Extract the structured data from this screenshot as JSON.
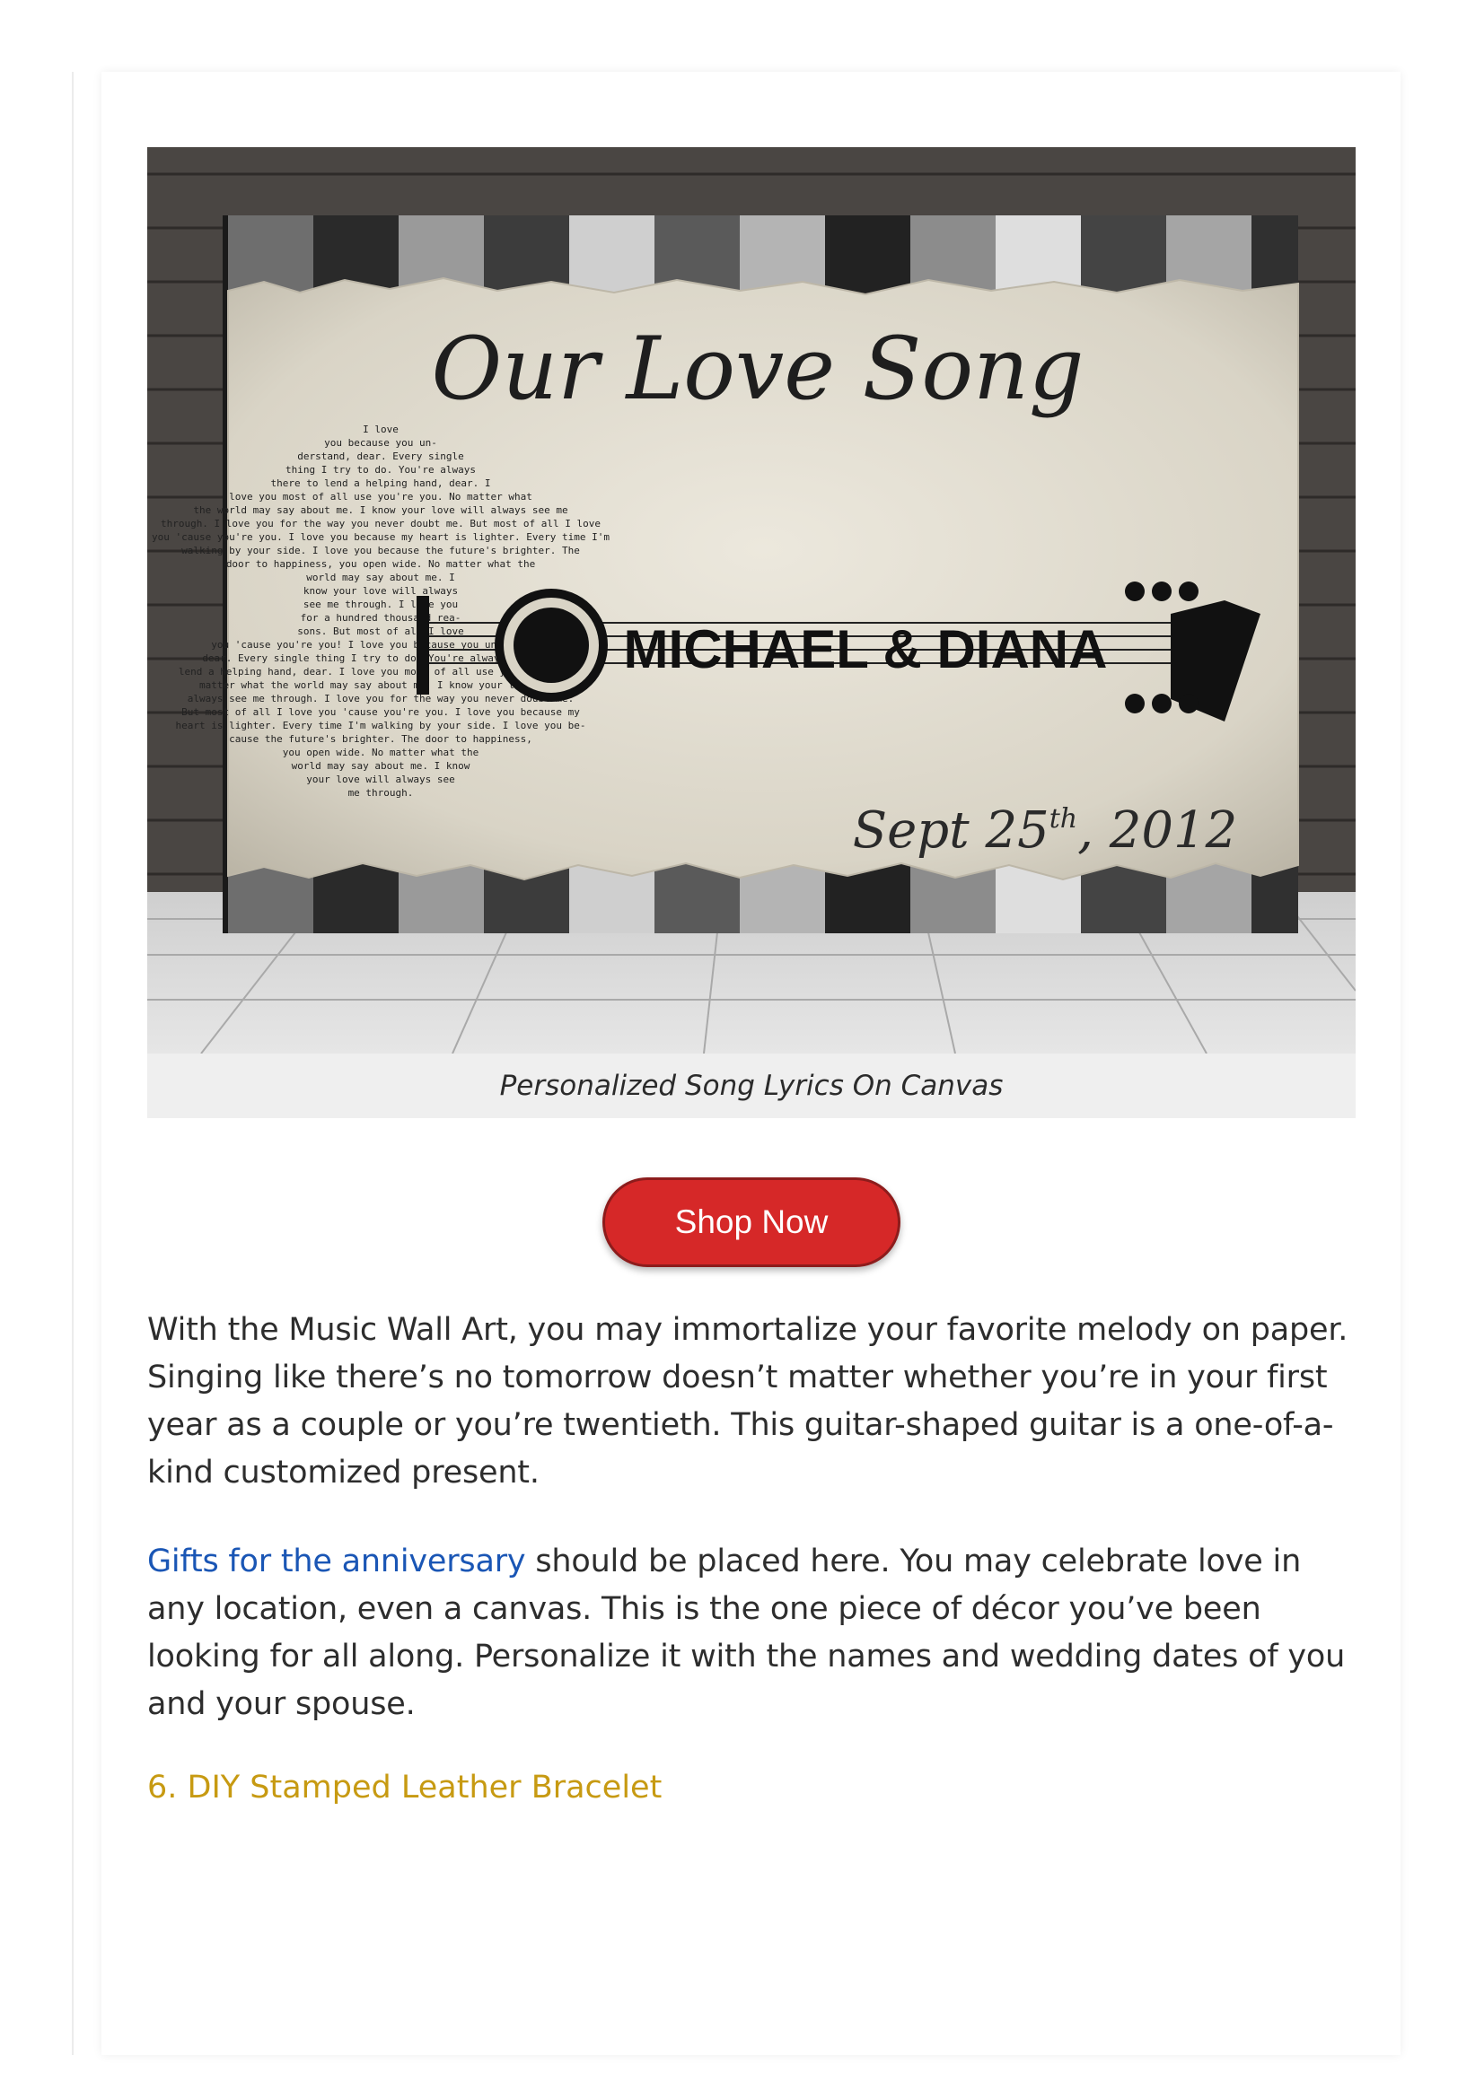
{
  "product": {
    "image_title": "Our Love Song",
    "image_names": "MICHAEL & DIANA",
    "image_date_main": "Sept 25",
    "image_date_suffix": "th",
    "image_date_year": ", 2012",
    "image_lyrics": [
      "I love",
      "you because you un-",
      "derstand, dear. Every single",
      "thing I try to do. You're always",
      "there to lend a helping hand, dear. I",
      "love you most of all use you're you. No matter what",
      "the world may say about me. I know your love will always see me",
      "through. I love you for the way you never doubt me. But most of all I love",
      "you 'cause you're you. I love you because my heart is lighter. Every time I'm",
      "walking by your side. I love you because the future's brighter. The",
      "door to happiness, you open wide. No matter what the",
      "world may say about me. I",
      "know your love will always",
      "see me through. I love you",
      "for a hundred thousand rea-",
      "sons. But most of all I love",
      "you 'cause you're you! I love you because you understand,",
      "dear. Every single thing I try to do. You're always there to",
      "lend a helping hand, dear. I love you most of all use you're you. No",
      "matter what the world may say about me. I know your love will",
      "always see me through. I love you for the way you never doubt me.",
      "But most of all I love you 'cause you're you. I love you because my",
      "heart is lighter. Every time I'm walking by your side. I love you be-",
      "cause the future's brighter. The door to happiness,",
      "you open wide. No matter what the",
      "world may say about me. I know",
      "your love will always see",
      "me through."
    ],
    "caption": "Personalized Song Lyrics On Canvas"
  },
  "cta": {
    "label": "Shop Now"
  },
  "body": {
    "paragraph1": "With the Music Wall Art, you may immortalize your favorite melody on paper. Singing like there’s no tomorrow doesn’t matter whether you’re in your first year as a couple or you’re twentieth. This guitar-shaped guitar is a one-of-a-kind customized present.",
    "paragraph2_link": "Gifts for the anniversary",
    "paragraph2_rest": " should be placed here. You may celebrate love in any location, even a canvas. This is the one piece of décor you’ve been looking for all along. Personalize it with the names and wedding dates of you and your spouse.",
    "next_heading": "6. DIY Stamped Leather Bracelet"
  },
  "colors": {
    "button_red": "#d62828",
    "link_blue": "#1a56b5",
    "heading_gold": "#c79a12",
    "caption_bg": "#efefef",
    "text": "#2d2d2d"
  }
}
